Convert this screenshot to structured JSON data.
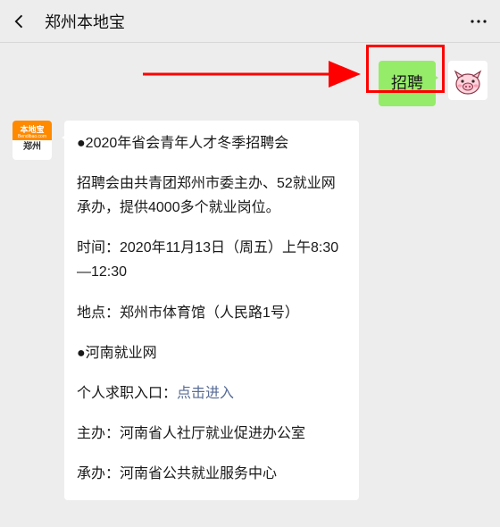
{
  "header": {
    "title": "郑州本地宝"
  },
  "outgoing": {
    "text": "招聘"
  },
  "avatar_bdb": {
    "top": "本地宝",
    "sub": "Bendibao.com",
    "bottom": "郑州"
  },
  "article": {
    "line1": "●2020年省会青年人才冬季招聘会",
    "line2": "招聘会由共青团郑州市委主办、52就业网承办，提供4000多个就业岗位。",
    "line3": "时间：2020年11月13日（周五）上午8:30—12:30",
    "line4": "地点：郑州市体育馆（人民路1号）",
    "line5": "●河南就业网",
    "line6_pre": "个人求职入口：",
    "line6_link": "点击进入",
    "line7": "主办：河南省人社厅就业促进办公室",
    "line8": "承办：河南省公共就业服务中心"
  }
}
